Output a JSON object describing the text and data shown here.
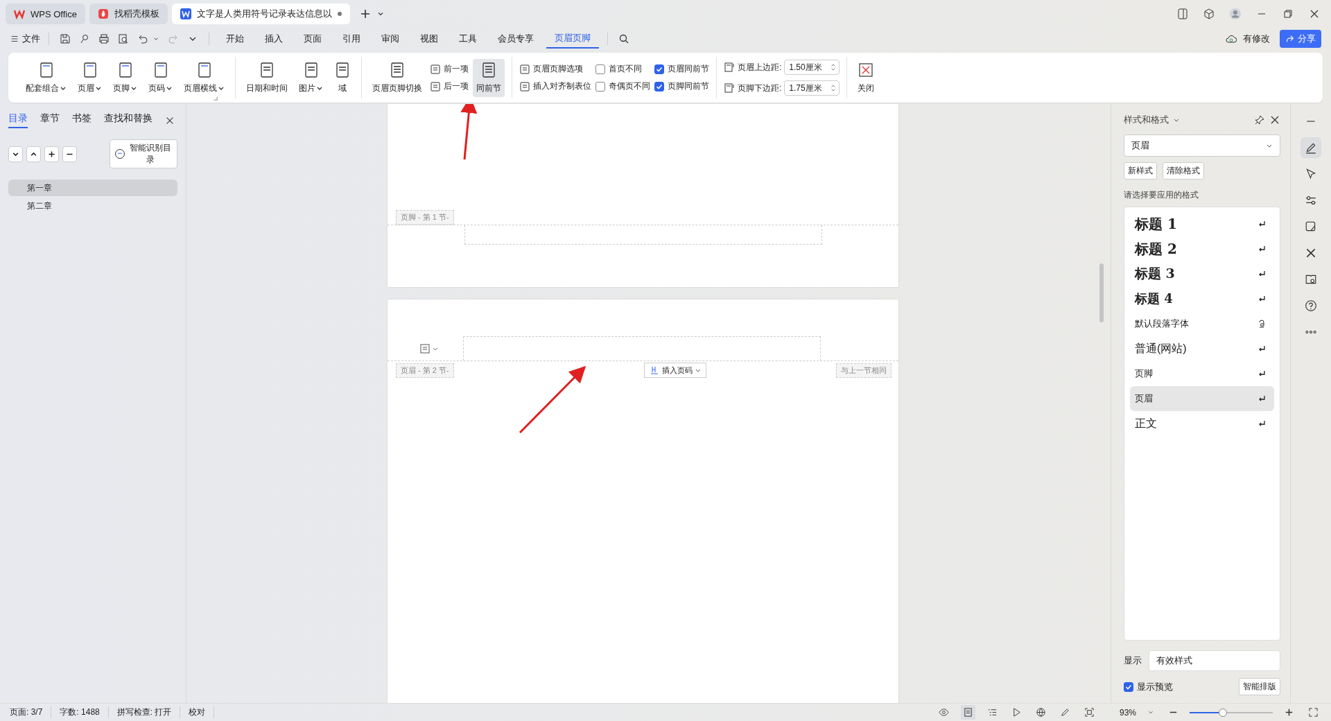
{
  "window_tabs": [
    {
      "label": "WPS Office",
      "kind": "home",
      "selected": false
    },
    {
      "label": "找稻壳模板",
      "kind": "template",
      "selected": false
    },
    {
      "label": "文字是人类用符号记录表达信息以",
      "kind": "document",
      "selected": true,
      "unsaved": true
    }
  ],
  "menu": {
    "file": "文件",
    "tabs": [
      {
        "label": "开始",
        "selected": false
      },
      {
        "label": "插入",
        "selected": false
      },
      {
        "label": "页面",
        "selected": false
      },
      {
        "label": "引用",
        "selected": false
      },
      {
        "label": "审阅",
        "selected": false
      },
      {
        "label": "视图",
        "selected": false
      },
      {
        "label": "工具",
        "selected": false
      },
      {
        "label": "会员专享",
        "selected": false
      },
      {
        "label": "页眉页脚",
        "selected": true
      }
    ],
    "sync_status": "有修改",
    "share": "分享"
  },
  "ribbon": [
    {
      "columns": [
        {
          "kind": "large",
          "label": "配套组合",
          "dropdown": true
        },
        {
          "kind": "large",
          "label": "页眉",
          "dropdown": true
        },
        {
          "kind": "large",
          "label": "页脚",
          "dropdown": true
        },
        {
          "kind": "large",
          "label": "页码",
          "dropdown": true
        },
        {
          "kind": "large",
          "label": "页眉横线",
          "dropdown": true
        }
      ]
    },
    {
      "columns": [
        {
          "kind": "large",
          "label": "日期和时间",
          "dropdown": false
        },
        {
          "kind": "large",
          "label": "图片",
          "dropdown": true
        },
        {
          "kind": "large",
          "label": "域",
          "dropdown": false
        }
      ]
    },
    {
      "columns": [
        {
          "kind": "large",
          "label": "页眉页脚切换",
          "dropdown": false
        },
        {
          "kind": "small",
          "items": [
            {
              "label": "前一项"
            },
            {
              "label": "后一项"
            }
          ]
        },
        {
          "kind": "large",
          "label": "同前节",
          "dropdown": false,
          "selected": true
        }
      ]
    },
    {
      "columns": [
        {
          "kind": "small",
          "items": [
            {
              "label": "页眉页脚选项"
            },
            {
              "label": "插入对齐制表位"
            }
          ]
        },
        {
          "kind": "checks",
          "items": [
            {
              "label": "首页不同",
              "checked": false
            },
            {
              "label": "奇偶页不同",
              "checked": false
            }
          ]
        },
        {
          "kind": "checks",
          "items": [
            {
              "label": "页眉同前节",
              "checked": true
            },
            {
              "label": "页脚同前节",
              "checked": true
            }
          ]
        }
      ]
    },
    {
      "columns": [
        {
          "kind": "spinners",
          "items": [
            {
              "label": "页眉上边距:",
              "value": "1.50厘米"
            },
            {
              "label": "页脚下边距:",
              "value": "1.75厘米"
            }
          ]
        }
      ]
    },
    {
      "columns": [
        {
          "kind": "close",
          "label": "关闭",
          "dropdown": false
        }
      ]
    }
  ],
  "nav_panel": {
    "tabs": [
      {
        "label": "目录",
        "selected": true
      },
      {
        "label": "章节",
        "selected": false
      },
      {
        "label": "书签",
        "selected": false
      },
      {
        "label": "查找和替换",
        "selected": false
      }
    ],
    "smart_button": "智能识别目录",
    "outline": [
      {
        "label": "第一章",
        "selected": true
      },
      {
        "label": "第二章",
        "selected": false
      }
    ]
  },
  "document": {
    "footer_label": "页脚 - 第 1 节-",
    "header_label": "页眉 - 第 2 节-",
    "insert_page_number": "插入页码",
    "same_as_previous": "与上一节相同"
  },
  "styles_panel": {
    "title": "样式和格式",
    "current_style": "页眉",
    "buttons": [
      "新样式",
      "清除格式"
    ],
    "prompt": "请选择要应用的格式",
    "styles": [
      {
        "label": "标题 1",
        "kind": "heading1",
        "character_style": false,
        "selected": false
      },
      {
        "label": "标题 2",
        "kind": "heading2",
        "character_style": false,
        "selected": false
      },
      {
        "label": "标题 3",
        "kind": "heading3",
        "character_style": false,
        "selected": false
      },
      {
        "label": "标题 4",
        "kind": "heading4",
        "character_style": false,
        "selected": false
      },
      {
        "label": "默认段落字体",
        "kind": "plain",
        "character_style": true,
        "selected": false
      },
      {
        "label": "普通(网站)",
        "kind": "large",
        "character_style": false,
        "selected": false
      },
      {
        "label": "页脚",
        "kind": "plain",
        "character_style": false,
        "selected": false
      },
      {
        "label": "页眉",
        "kind": "plain",
        "character_style": false,
        "selected": true
      },
      {
        "label": "正文",
        "kind": "large",
        "character_style": false,
        "selected": false
      }
    ],
    "show_label": "显示",
    "show_value": "有效样式",
    "preview": {
      "label": "显示预览",
      "checked": true
    },
    "smart_layout": "智能排版"
  },
  "status_bar": {
    "page": "页面: 3/7",
    "words": "字数: 1488",
    "spell_check": "拼写检查: 打开",
    "proofread": "校对",
    "zoom": "93%",
    "zoom_slider": {
      "level": 0.4
    }
  }
}
